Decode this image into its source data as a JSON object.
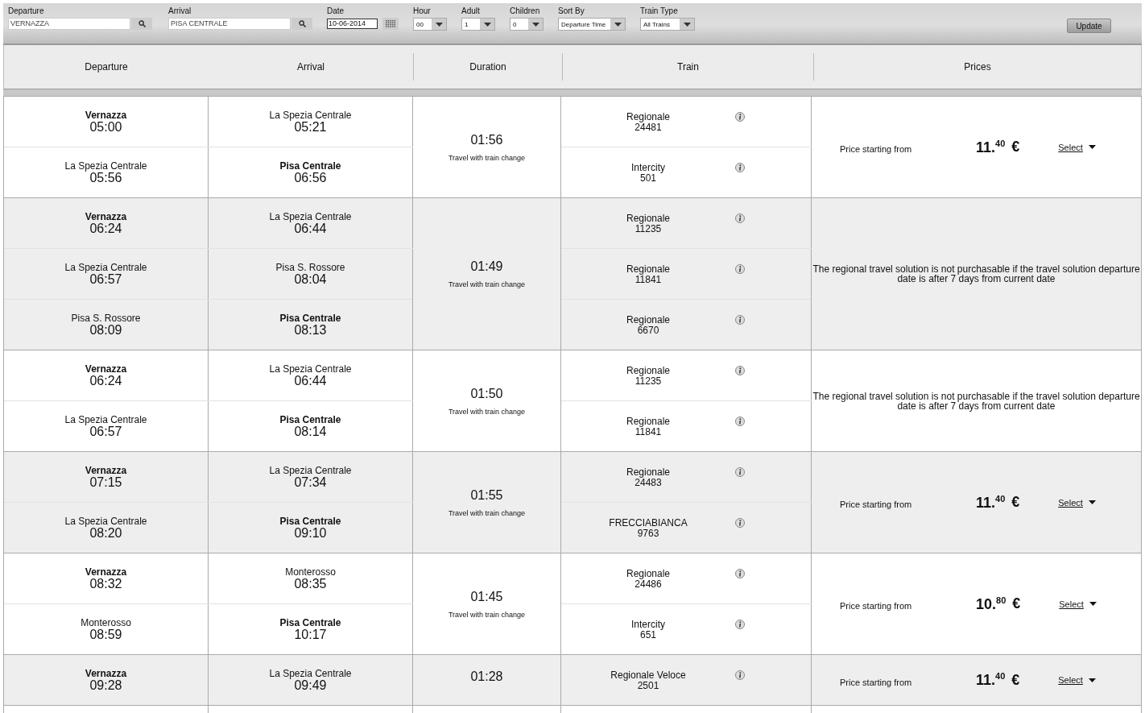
{
  "filters": [
    {
      "kind": "search",
      "label": "Departure",
      "value": "VERNAZZA"
    },
    {
      "kind": "search",
      "label": "Arrival",
      "value": "PISA CENTRALE"
    },
    {
      "kind": "date",
      "label": "Date",
      "value": "10-06-2014"
    },
    {
      "kind": "select",
      "label": "Hour",
      "value": "00"
    },
    {
      "kind": "select",
      "label": "Adult",
      "value": "1"
    },
    {
      "kind": "select",
      "label": "Children",
      "value": "0"
    },
    {
      "kind": "select",
      "label": "Sort By",
      "value": "Departure Time"
    },
    {
      "kind": "select",
      "label": "Train Type",
      "value": "All Trains"
    }
  ],
  "update_button": "Update",
  "table": {
    "columns": [
      "Departure",
      "Arrival",
      "Duration",
      "Train",
      "Prices"
    ],
    "groups": [
      {
        "legs": [
          {
            "from": {
              "station": "Vernazza",
              "time": "05:00",
              "bold": true
            },
            "to": {
              "station": "La Spezia Centrale",
              "time": "05:21",
              "bold": false
            },
            "train": "Regionale",
            "number": "24481"
          },
          {
            "from": {
              "station": "La Spezia Centrale",
              "time": "05:56",
              "bold": false
            },
            "to": {
              "station": "Pisa Centrale",
              "time": "06:56",
              "bold": true
            },
            "train": "Intercity",
            "number": "501"
          }
        ],
        "duration": "01:56",
        "note": "Travel with train change",
        "price": {
          "kind": "price",
          "label": "Price starting from",
          "amount": "11.$^{40}$",
          "currency": "€",
          "action": "Select"
        }
      },
      {
        "legs": [
          {
            "from": {
              "station": "Vernazza",
              "time": "06:24",
              "bold": true
            },
            "to": {
              "station": "La Spezia Centrale",
              "time": "06:44",
              "bold": false
            },
            "train": "Regionale",
            "number": "11235"
          },
          {
            "from": {
              "station": "La Spezia Centrale",
              "time": "06:57",
              "bold": false
            },
            "to": {
              "station": "Pisa S. Rossore",
              "time": "08:04",
              "bold": false
            },
            "train": "Regionale",
            "number": "11841"
          },
          {
            "from": {
              "station": "Pisa S. Rossore",
              "time": "08:09",
              "bold": false
            },
            "to": {
              "station": "Pisa Centrale",
              "time": "08:13",
              "bold": true
            },
            "train": "Regionale",
            "number": "6670"
          }
        ],
        "duration": "01:49",
        "note": "Travel with train change",
        "price": {
          "kind": "notice",
          "text": "The regional travel solution is not purchasable if the travel solution departure date is after 7 days from current date"
        }
      },
      {
        "legs": [
          {
            "from": {
              "station": "Vernazza",
              "time": "06:24",
              "bold": true
            },
            "to": {
              "station": "La Spezia Centrale",
              "time": "06:44",
              "bold": false
            },
            "train": "Regionale",
            "number": "11235"
          },
          {
            "from": {
              "station": "La Spezia Centrale",
              "time": "06:57",
              "bold": false
            },
            "to": {
              "station": "Pisa Centrale",
              "time": "08:14",
              "bold": true
            },
            "train": "Regionale",
            "number": "11841"
          }
        ],
        "duration": "01:50",
        "note": "Travel with train change",
        "price": {
          "kind": "notice",
          "text": "The regional travel solution is not purchasable if the travel solution departure date is after 7 days from current date"
        }
      },
      {
        "legs": [
          {
            "from": {
              "station": "Vernazza",
              "time": "07:15",
              "bold": true
            },
            "to": {
              "station": "La Spezia Centrale",
              "time": "07:34",
              "bold": false
            },
            "train": "Regionale",
            "number": "24483"
          },
          {
            "from": {
              "station": "La Spezia Centrale",
              "time": "08:20",
              "bold": false
            },
            "to": {
              "station": "Pisa Centrale",
              "time": "09:10",
              "bold": true
            },
            "train": "FRECCIABIANCA",
            "number": "9763"
          }
        ],
        "duration": "01:55",
        "note": "Travel with train change",
        "price": {
          "kind": "price",
          "label": "Price starting from",
          "amount": "11.$^{40}$",
          "currency": "€",
          "action": "Select"
        }
      },
      {
        "legs": [
          {
            "from": {
              "station": "Vernazza",
              "time": "08:32",
              "bold": true
            },
            "to": {
              "station": "Monterosso",
              "time": "08:35",
              "bold": false
            },
            "train": "Regionale",
            "number": "24486"
          },
          {
            "from": {
              "station": "Monterosso",
              "time": "08:59",
              "bold": false
            },
            "to": {
              "station": "Pisa Centrale",
              "time": "10:17",
              "bold": true
            },
            "train": "Intercity",
            "number": "651"
          }
        ],
        "duration": "01:45",
        "note": "Travel with train change",
        "price": {
          "kind": "price",
          "label": "Price starting from",
          "amount": "10.$^{80}$",
          "currency": "€",
          "action": "Select"
        }
      },
      {
        "legs": [
          {
            "from": {
              "station": "Vernazza",
              "time": "09:28",
              "bold": true
            },
            "to": {
              "station": "La Spezia Centrale",
              "time": "09:49",
              "bold": false
            },
            "train": "Regionale Veloce",
            "number": "2501"
          }
        ],
        "duration": "01:28",
        "price": {
          "kind": "price",
          "label": "Price starting from",
          "amount": "11.$^{40}$",
          "currency": "€",
          "action": "Select"
        }
      }
    ]
  }
}
